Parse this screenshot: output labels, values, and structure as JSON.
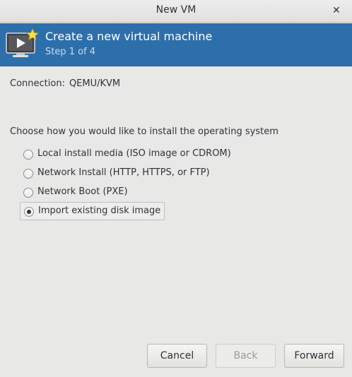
{
  "window": {
    "title": "New VM",
    "close_symbol": "✕"
  },
  "banner": {
    "heading": "Create a new virtual machine",
    "step": "Step 1 of 4",
    "icon": "vm-monitor-new-icon"
  },
  "connection": {
    "label": "Connection:",
    "value": "QEMU/KVM"
  },
  "install": {
    "question": "Choose how you would like to install the operating system",
    "options": [
      {
        "label": "Local install media (ISO image or CDROM)",
        "selected": false
      },
      {
        "label": "Network Install (HTTP, HTTPS, or FTP)",
        "selected": false
      },
      {
        "label": "Network Boot (PXE)",
        "selected": false
      },
      {
        "label": "Import existing disk image",
        "selected": true
      }
    ]
  },
  "buttons": {
    "cancel": "Cancel",
    "back": "Back",
    "forward": "Forward",
    "back_enabled": false
  },
  "colors": {
    "banner": "#2d6fab",
    "banner_subtext": "#c9dbee",
    "window_bg": "#e8e8e7"
  }
}
